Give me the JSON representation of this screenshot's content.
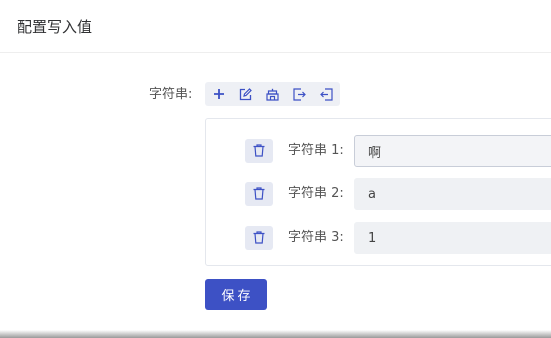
{
  "dialog": {
    "title": "配置写入值"
  },
  "form": {
    "label": "字符串:",
    "toolbar": [
      {
        "icon": "plus-icon"
      },
      {
        "icon": "edit-icon"
      },
      {
        "icon": "batch-icon"
      },
      {
        "icon": "export-icon"
      },
      {
        "icon": "import-icon"
      }
    ],
    "items": [
      {
        "label": "字符串 1:",
        "value": "啊"
      },
      {
        "label": "字符串 2:",
        "value": "a"
      },
      {
        "label": "字符串 3:",
        "value": "1"
      }
    ],
    "save_label": "保存"
  },
  "colors": {
    "accent": "#3d51c5",
    "icon": "#3d51c5",
    "toolbar_bg": "#eef0f5",
    "input_bg": "#eff1f4"
  }
}
